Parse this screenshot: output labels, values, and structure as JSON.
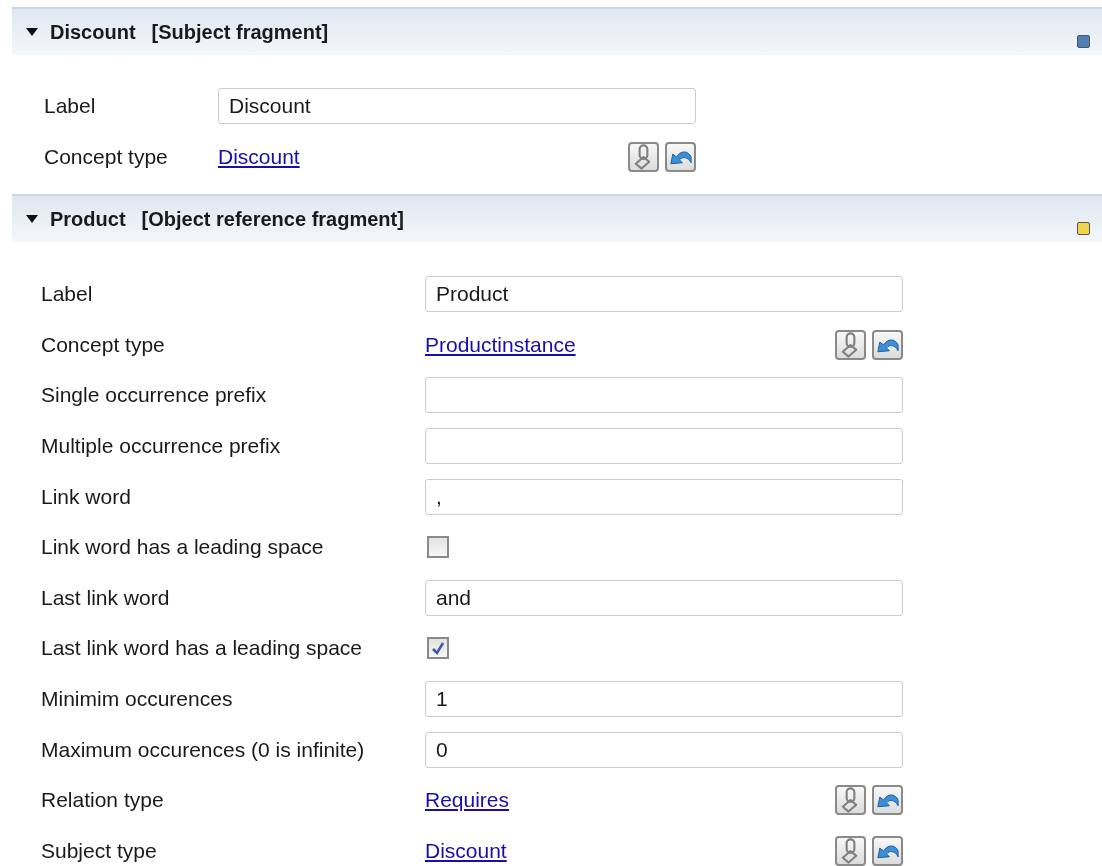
{
  "sections": [
    {
      "title": "Discount",
      "subtitle": "[Subject fragment]",
      "expanded": true,
      "color": "#4f7fb8",
      "rows": [
        {
          "kind": "text",
          "label": "Label",
          "value": "Discount"
        },
        {
          "kind": "link",
          "label": "Concept type",
          "value": "Discount"
        }
      ]
    },
    {
      "title": "Product",
      "subtitle": "[Object reference fragment]",
      "expanded": true,
      "color": "#f2d24c",
      "rows": [
        {
          "kind": "text",
          "label": "Label",
          "value": "Product"
        },
        {
          "kind": "link",
          "label": "Concept type",
          "value": "Productinstance"
        },
        {
          "kind": "text",
          "label": "Single occurrence prefix"
        },
        {
          "kind": "text",
          "label": "Multiple occurrence prefix"
        },
        {
          "kind": "text",
          "label": "Link word",
          "value": ","
        },
        {
          "kind": "checkbox",
          "label": "Link word has a leading space",
          "checked": false
        },
        {
          "kind": "text",
          "label": "Last link word",
          "value": "and"
        },
        {
          "kind": "checkbox",
          "label": "Last link word has a leading space",
          "checked": true
        },
        {
          "kind": "text",
          "label": "Minimim occurences",
          "value": "1"
        },
        {
          "kind": "text",
          "label": "Maximum occurences (0 is infinite)",
          "value": "0"
        },
        {
          "kind": "link",
          "label": "Relation type",
          "value": "Requires"
        },
        {
          "kind": "link",
          "label": "Subject type",
          "value": "Discount"
        }
      ]
    }
  ]
}
